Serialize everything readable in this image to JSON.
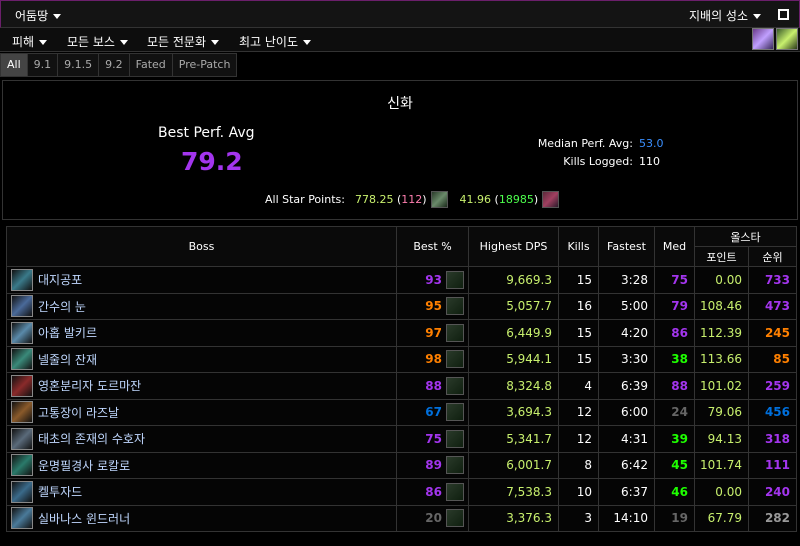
{
  "topbar": {
    "dungeon": "어둠땅",
    "raid": "지배의 성소"
  },
  "filters": [
    "피해",
    "모든 보스",
    "모든 전문화",
    "최고 난이도"
  ],
  "tabs": [
    "All",
    "9.1",
    "9.1.5",
    "9.2",
    "Fated",
    "Pre-Patch"
  ],
  "summary": {
    "difficulty": "신화",
    "best_perf_label": "Best Perf. Avg",
    "best_perf_value": "79.2",
    "median_label": "Median Perf. Avg:",
    "median_value": "53.0",
    "kills_label": "Kills Logged:",
    "kills_value": "110",
    "star_label": "All Star Points:",
    "star_points_1": "778.25",
    "star_rank_1": "112",
    "star_points_2": "41.96",
    "star_rank_2": "18985"
  },
  "table": {
    "headers": {
      "boss": "Boss",
      "best": "Best %",
      "dps": "Highest DPS",
      "kills": "Kills",
      "fastest": "Fastest",
      "med": "Med",
      "allstar": "올스타",
      "points": "포인트",
      "rank": "순위"
    },
    "rows": [
      {
        "boss": "대지공포",
        "best": "93",
        "best_color": "#a335ee",
        "dps": "9,669.3",
        "kills": "15",
        "fastest": "3:28",
        "med": "75",
        "med_color": "#a335ee",
        "points": "0.00",
        "rank": "733",
        "rank_color": "#a335ee",
        "icon_color": "#3a7a8a"
      },
      {
        "boss": "간수의 눈",
        "best": "95",
        "best_color": "#ff8000",
        "dps": "5,057.7",
        "kills": "16",
        "fastest": "5:00",
        "med": "79",
        "med_color": "#a335ee",
        "points": "108.46",
        "rank": "473",
        "rank_color": "#a335ee",
        "icon_color": "#4a6a9a"
      },
      {
        "boss": "아홉 발키르",
        "best": "97",
        "best_color": "#ff8000",
        "dps": "6,449.9",
        "kills": "15",
        "fastest": "4:20",
        "med": "86",
        "med_color": "#a335ee",
        "points": "112.39",
        "rank": "245",
        "rank_color": "#ff8000",
        "icon_color": "#5a8aaa"
      },
      {
        "boss": "넬줄의 잔재",
        "best": "98",
        "best_color": "#ff8000",
        "dps": "5,944.1",
        "kills": "15",
        "fastest": "3:30",
        "med": "38",
        "med_color": "#1eff00",
        "points": "113.66",
        "rank": "85",
        "rank_color": "#ff8000",
        "icon_color": "#3a8a7a"
      },
      {
        "boss": "영혼분리자 도르마잔",
        "best": "88",
        "best_color": "#a335ee",
        "dps": "8,324.8",
        "kills": "4",
        "fastest": "6:39",
        "med": "88",
        "med_color": "#a335ee",
        "points": "101.02",
        "rank": "259",
        "rank_color": "#a335ee",
        "icon_color": "#8a2a2a"
      },
      {
        "boss": "고통장이 라즈날",
        "best": "67",
        "best_color": "#0070dd",
        "dps": "3,694.3",
        "kills": "12",
        "fastest": "6:00",
        "med": "24",
        "med_color": "#666666",
        "points": "79.06",
        "rank": "456",
        "rank_color": "#0070dd",
        "icon_color": "#8a5a2a"
      },
      {
        "boss": "태초의 존재의 수호자",
        "best": "75",
        "best_color": "#a335ee",
        "dps": "5,341.7",
        "kills": "12",
        "fastest": "4:31",
        "med": "39",
        "med_color": "#1eff00",
        "points": "94.13",
        "rank": "318",
        "rank_color": "#a335ee",
        "icon_color": "#5a6a7a"
      },
      {
        "boss": "운명필경사 로칼로",
        "best": "89",
        "best_color": "#a335ee",
        "dps": "6,001.7",
        "kills": "8",
        "fastest": "6:42",
        "med": "45",
        "med_color": "#1eff00",
        "points": "101.74",
        "rank": "111",
        "rank_color": "#a335ee",
        "icon_color": "#2a7a6a"
      },
      {
        "boss": "켈투자드",
        "best": "86",
        "best_color": "#a335ee",
        "dps": "7,538.3",
        "kills": "10",
        "fastest": "6:37",
        "med": "46",
        "med_color": "#1eff00",
        "points": "0.00",
        "rank": "240",
        "rank_color": "#a335ee",
        "icon_color": "#3a6a8a"
      },
      {
        "boss": "실바나스 윈드러너",
        "best": "20",
        "best_color": "#666666",
        "dps": "3,376.3",
        "kills": "3",
        "fastest": "14:10",
        "med": "19",
        "med_color": "#666666",
        "points": "67.79",
        "rank": "282",
        "rank_color": "#999999",
        "icon_color": "#4a7a9a"
      }
    ]
  }
}
